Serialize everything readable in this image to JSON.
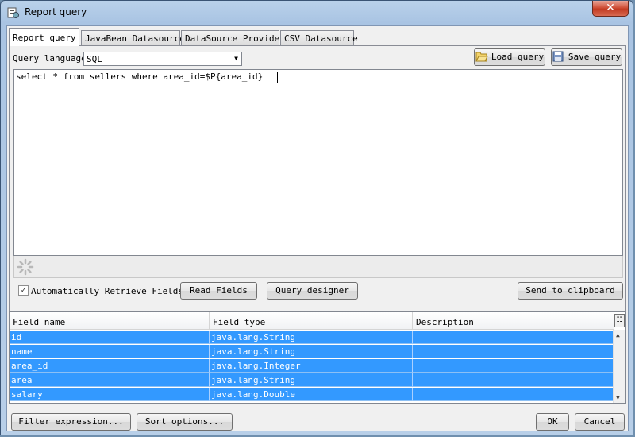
{
  "window": {
    "title": "Report query"
  },
  "tabs": [
    {
      "label": "Report query",
      "active": true
    },
    {
      "label": "JavaBean Datasource",
      "active": false
    },
    {
      "label": "DataSource Provider",
      "active": false
    },
    {
      "label": "CSV Datasource",
      "active": false
    }
  ],
  "query": {
    "language_label": "Query language",
    "language_value": "SQL",
    "load_label": "Load query",
    "save_label": "Save query",
    "text": "select * from sellers where area_id=$P{area_id}"
  },
  "options": {
    "auto_retrieve_label": "Automatically Retrieve Fields",
    "auto_retrieve_checked": true,
    "read_fields_label": "Read Fields",
    "query_designer_label": "Query designer",
    "send_clipboard_label": "Send to clipboard"
  },
  "fields_table": {
    "columns": [
      "Field name",
      "Field type",
      "Description"
    ],
    "rows": [
      {
        "name": "id",
        "type": "java.lang.String",
        "description": ""
      },
      {
        "name": "name",
        "type": "java.lang.String",
        "description": ""
      },
      {
        "name": "area_id",
        "type": "java.lang.Integer",
        "description": ""
      },
      {
        "name": "area",
        "type": "java.lang.String",
        "description": ""
      },
      {
        "name": "salary",
        "type": "java.lang.Double",
        "description": ""
      }
    ],
    "selection_color": "#3399ff"
  },
  "footer": {
    "filter_label": "Filter expression...",
    "sort_label": "Sort options...",
    "ok_label": "OK",
    "cancel_label": "Cancel"
  },
  "icons": [
    "report-app-icon",
    "close-icon",
    "folder-open-icon",
    "save-icon",
    "loading-spinner-icon",
    "chevron-down-icon",
    "column-chooser-icon"
  ]
}
